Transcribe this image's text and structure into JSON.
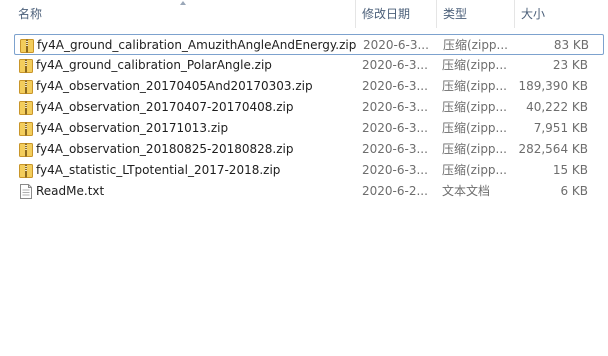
{
  "columns": {
    "name": "名称",
    "modified": "修改日期",
    "type": "类型",
    "size": "大小"
  },
  "files": [
    {
      "name": "fy4A_ground_calibration_AmuzithAngleAndEnergy.zip",
      "modified": "2020-6-3...",
      "type": "压缩(zipp...",
      "size": "83 KB",
      "icon": "zip-folder-icon",
      "selected": true
    },
    {
      "name": "fy4A_ground_calibration_PolarAngle.zip",
      "modified": "2020-6-3...",
      "type": "压缩(zipp...",
      "size": "23 KB",
      "icon": "zip-folder-icon"
    },
    {
      "name": "fy4A_observation_20170405And20170303.zip",
      "modified": "2020-6-3...",
      "type": "压缩(zipp...",
      "size": "189,390 KB",
      "icon": "zip-folder-icon"
    },
    {
      "name": "fy4A_observation_20170407-20170408.zip",
      "modified": "2020-6-3...",
      "type": "压缩(zipp...",
      "size": "40,222 KB",
      "icon": "zip-folder-icon"
    },
    {
      "name": "fy4A_observation_20171013.zip",
      "modified": "2020-6-3...",
      "type": "压缩(zipp...",
      "size": "7,951 KB",
      "icon": "zip-folder-icon"
    },
    {
      "name": "fy4A_observation_20180825-20180828.zip",
      "modified": "2020-6-3...",
      "type": "压缩(zipp...",
      "size": "282,564 KB",
      "icon": "zip-folder-icon"
    },
    {
      "name": "fy4A_statistic_LTpotential_2017-2018.zip",
      "modified": "2020-6-3...",
      "type": "压缩(zipp...",
      "size": "15 KB",
      "icon": "zip-folder-icon"
    },
    {
      "name": "ReadMe.txt",
      "modified": "2020-6-2...",
      "type": "文本文档",
      "size": "6 KB",
      "icon": "text-file-icon"
    }
  ],
  "colors": {
    "selection_border": "#7da2ce",
    "header_text": "#4c607a",
    "zip_folder": "#e8b73a"
  }
}
